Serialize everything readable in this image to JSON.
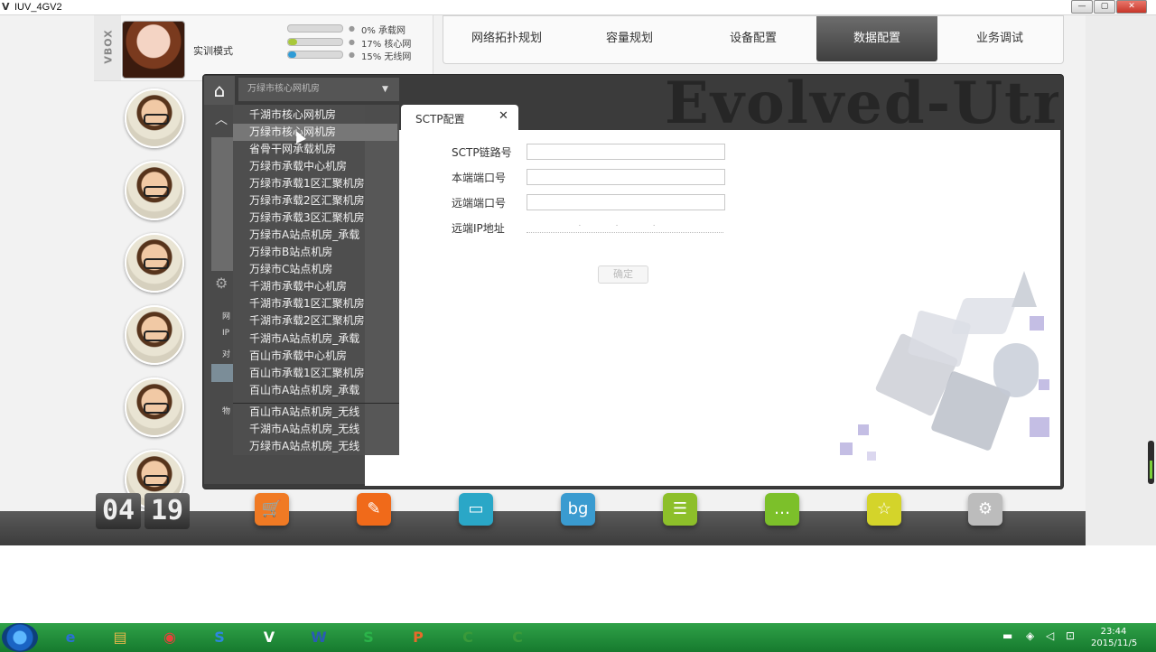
{
  "window": {
    "title": "IUV_4GV2",
    "logo": "V",
    "min": "—",
    "max": "▢",
    "close": "✕"
  },
  "header": {
    "vbox": "VBOX",
    "mode": "实训模式",
    "progress": [
      {
        "percent": 0,
        "label": "0% 承载网",
        "color": "#bbbbbb"
      },
      {
        "percent": 17,
        "label": "17% 核心网",
        "color": "#a8c83a"
      },
      {
        "percent": 15,
        "label": "15% 无线网",
        "color": "#2e9bd6"
      }
    ]
  },
  "nav": {
    "tabs": [
      "网络拓扑规划",
      "容量规划",
      "设备配置",
      "数据配置",
      "业务调试"
    ],
    "active": "数据配置"
  },
  "banner": "Evolved-Utran",
  "dropdown": {
    "items": [
      "千湖市核心网机房",
      "万绿市核心网机房",
      "省骨干网承载机房",
      "万绿市承载中心机房",
      "万绿市承载1区汇聚机房",
      "万绿市承载2区汇聚机房",
      "万绿市承载3区汇聚机房",
      "万绿市A站点机房_承载",
      "万绿市B站点机房",
      "万绿市C站点机房",
      "千湖市承载中心机房",
      "千湖市承载1区汇聚机房",
      "千湖市承载2区汇聚机房",
      "千湖市A站点机房_承载",
      "百山市承载中心机房",
      "百山市承载1区汇聚机房",
      "百山市A站点机房_承载"
    ],
    "wireless_items": [
      "百山市A站点机房_无线",
      "千湖市A站点机房_无线",
      "万绿市A站点机房_无线"
    ],
    "hovered": "万绿市核心网机房"
  },
  "sidebar": {
    "labels": [
      "网",
      "IP",
      "对",
      "物"
    ]
  },
  "form": {
    "tab_label": "SCTP配置",
    "tab_close": "✕",
    "fields": [
      {
        "label": "SCTP链路号",
        "value": ""
      },
      {
        "label": "本端端口号",
        "value": ""
      },
      {
        "label": "远端端口号",
        "value": ""
      },
      {
        "label": "远端IP地址",
        "value": ". . ."
      }
    ],
    "ok": "确定"
  },
  "dock": {
    "clock": {
      "hour": "04",
      "minute": "19"
    },
    "icons": [
      {
        "name": "cart-icon",
        "color": "#f07a24",
        "glyph": "🛒"
      },
      {
        "name": "notebook-icon",
        "color": "#f06a1a",
        "glyph": "✎"
      },
      {
        "name": "tv-icon",
        "color": "#2aa7c7",
        "glyph": "▭"
      },
      {
        "name": "bg-calendar-icon",
        "color": "#3a9bd0",
        "glyph": "bg"
      },
      {
        "name": "list-icon",
        "color": "#8dbf2a",
        "glyph": "☰"
      },
      {
        "name": "chat-icon",
        "color": "#7cc02a",
        "glyph": "…"
      },
      {
        "name": "star-icon",
        "color": "#d4d42a",
        "glyph": "☆"
      },
      {
        "name": "settings-icon",
        "color": "#bcbcbc",
        "glyph": "⚙"
      }
    ]
  },
  "taskbar": {
    "time": "23:44",
    "date": "2015/11/5",
    "apps": [
      {
        "name": "ie-icon",
        "glyph": "e",
        "color": "#2a6fd6"
      },
      {
        "name": "folder-icon",
        "glyph": "▤",
        "color": "#e8b84a"
      },
      {
        "name": "chrome-icon",
        "glyph": "◉",
        "color": "#e8413a"
      },
      {
        "name": "sogou-icon",
        "glyph": "S",
        "color": "#2d86e0"
      },
      {
        "name": "vbox-app-icon",
        "glyph": "V",
        "color": "#ffffff"
      },
      {
        "name": "word-icon",
        "glyph": "W",
        "color": "#2a5bb5"
      },
      {
        "name": "s-app-icon",
        "glyph": "S",
        "color": "#2bb44a"
      },
      {
        "name": "p-app-icon",
        "glyph": "P",
        "color": "#e86a2a"
      },
      {
        "name": "c-app-icon-1",
        "glyph": "C",
        "color": "#3a9a3a"
      },
      {
        "name": "c-app-icon-2",
        "glyph": "C",
        "color": "#3a9a3a"
      }
    ]
  }
}
